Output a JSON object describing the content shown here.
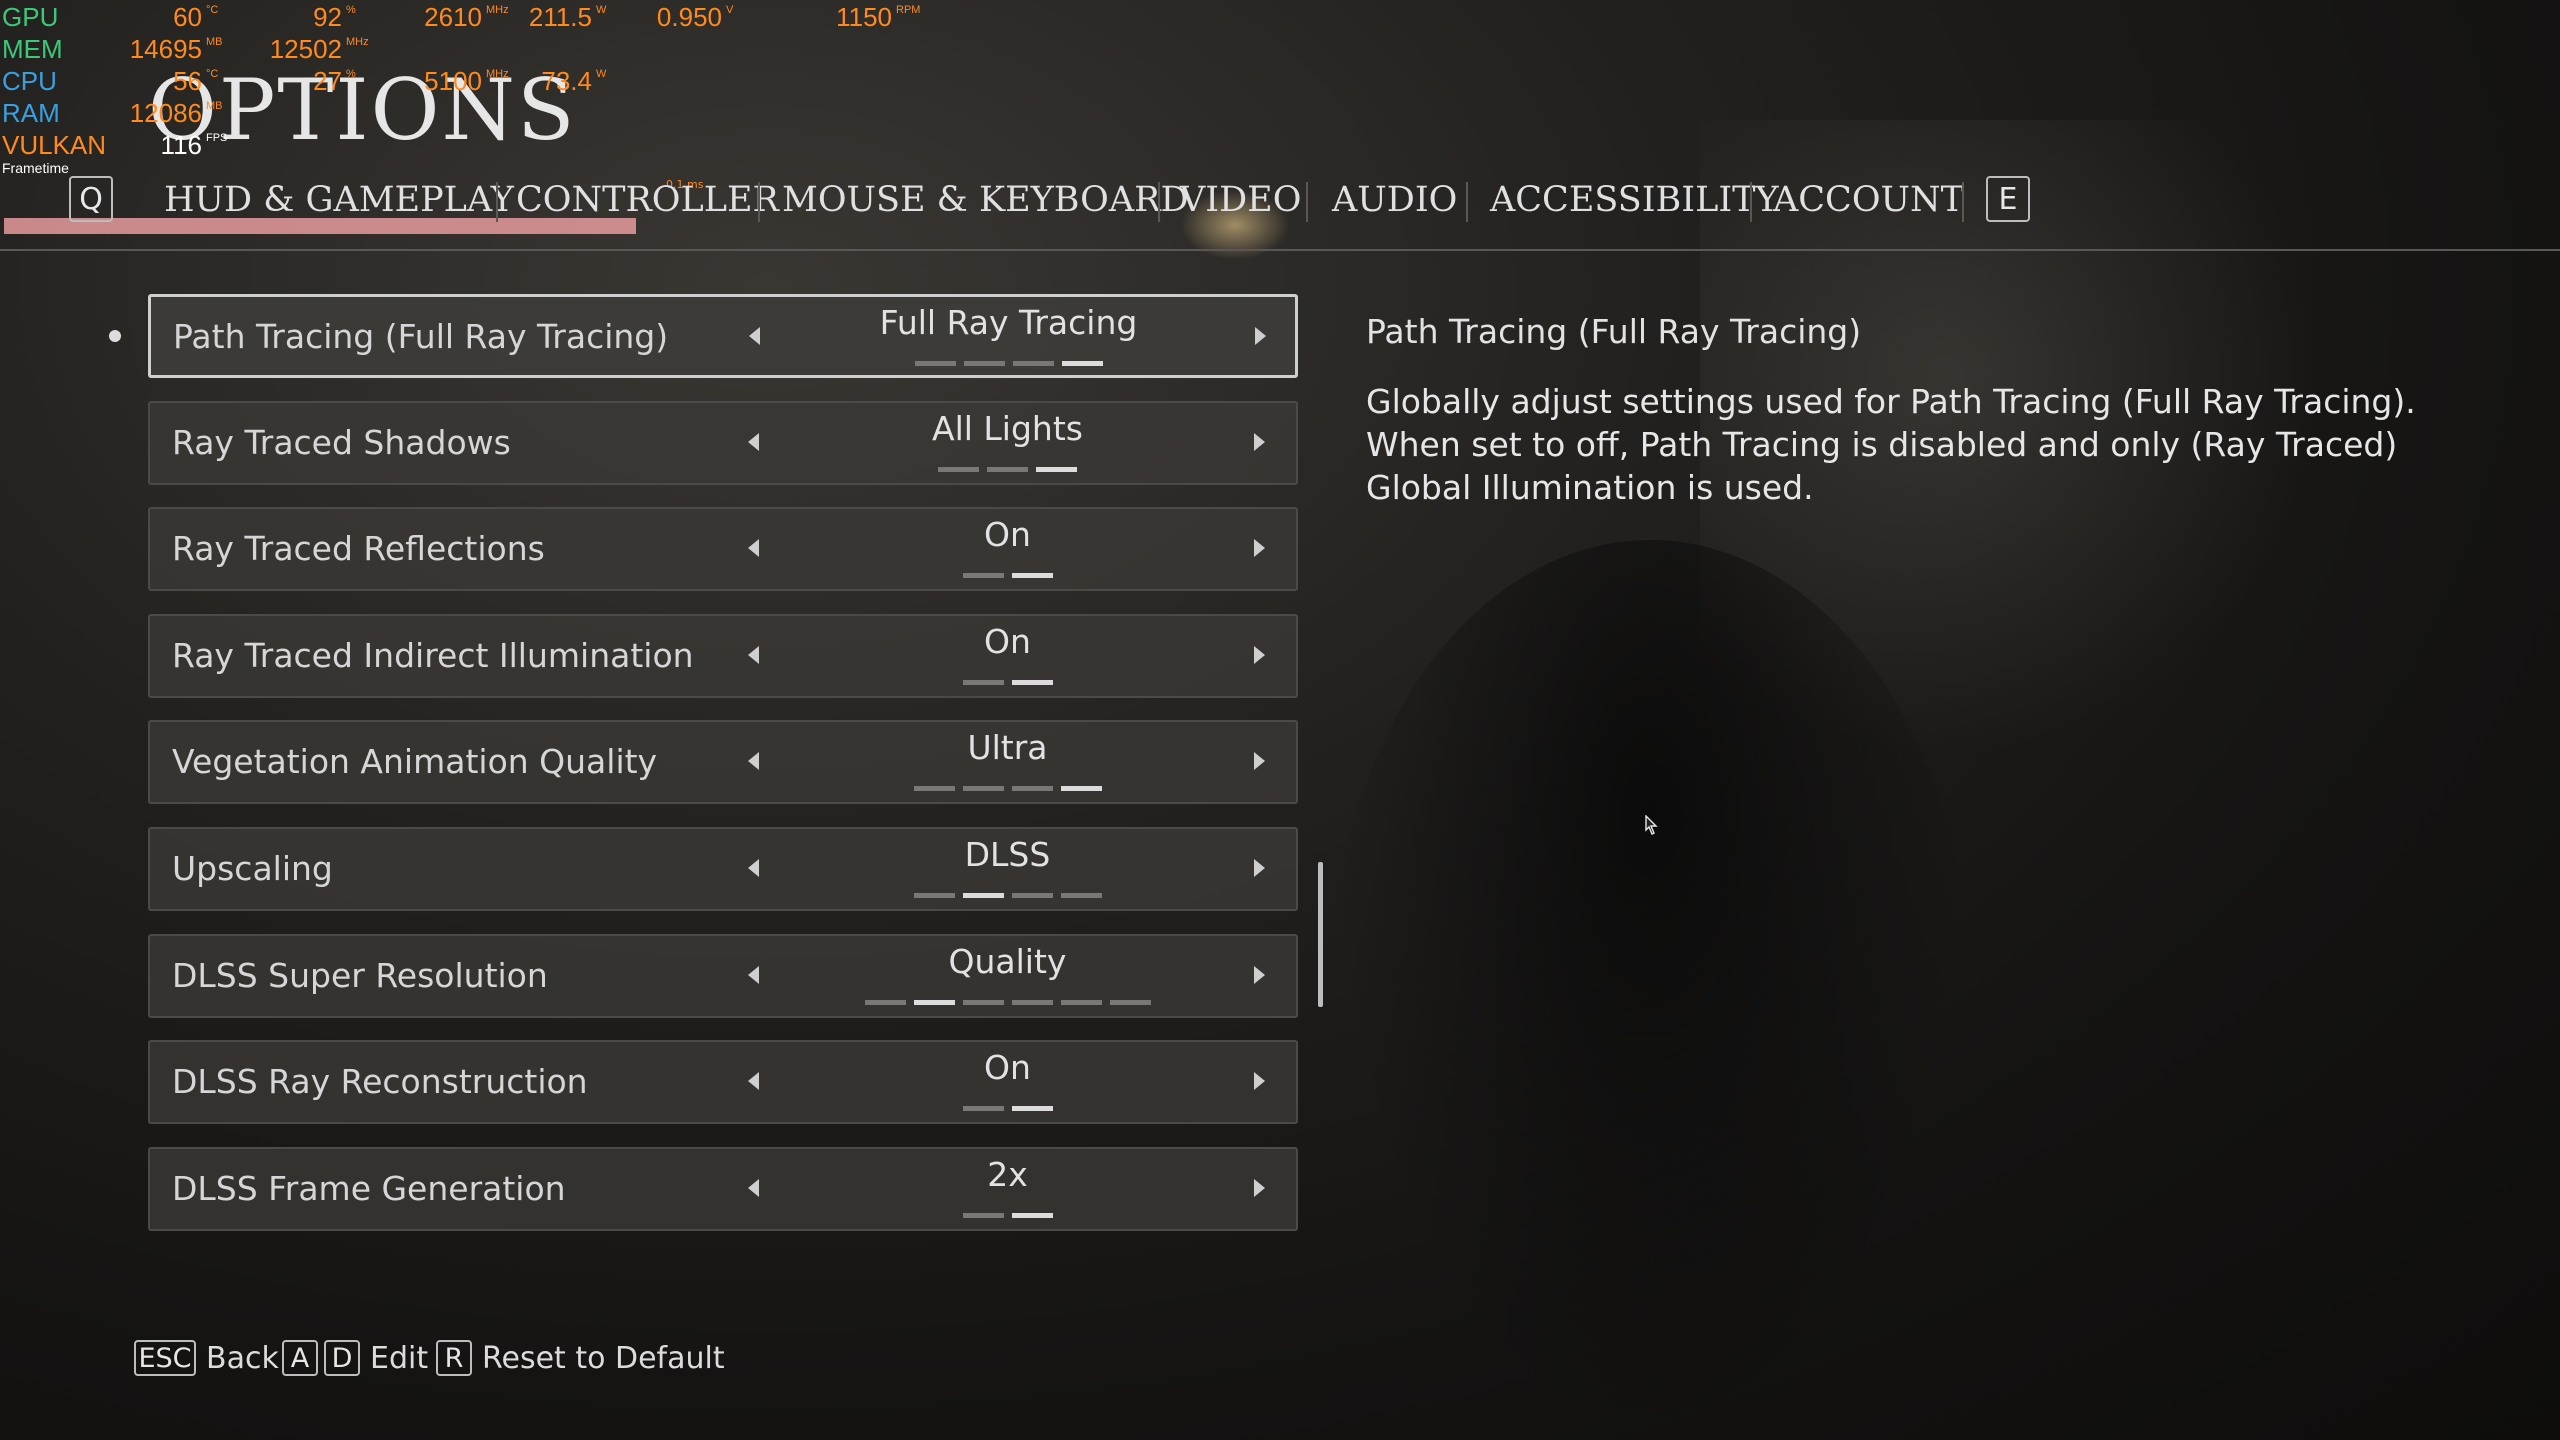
{
  "osd": {
    "rows": [
      {
        "label": "GPU",
        "label_color": "#3cc878",
        "values": [
          {
            "v": "60",
            "u": "°C"
          },
          {
            "v": "92",
            "u": "%"
          },
          {
            "v": "2610",
            "u": "MHz"
          },
          {
            "v": "211.5",
            "u": "W"
          },
          {
            "v": "0.950",
            "u": "V"
          },
          {
            "v": "1150",
            "u": "RPM"
          }
        ]
      },
      {
        "label": "MEM",
        "label_color": "#3cc878",
        "values": [
          {
            "v": "14695",
            "u": "MB"
          },
          {
            "v": "12502",
            "u": "MHz"
          }
        ]
      },
      {
        "label": "CPU",
        "label_color": "#3aa0e0",
        "values": [
          {
            "v": "56",
            "u": "°C"
          },
          {
            "v": "27",
            "u": "%"
          },
          {
            "v": "5100",
            "u": "MHz"
          },
          {
            "v": "73.4",
            "u": "W"
          }
        ]
      },
      {
        "label": "RAM",
        "label_color": "#3aa0e0",
        "values": [
          {
            "v": "12086",
            "u": "MB"
          }
        ]
      },
      {
        "label": "VULKAN",
        "label_color": "#ff8a1e",
        "values": [
          {
            "v": "116",
            "u": "FPS"
          }
        ]
      }
    ],
    "frametime_label": "Frametime",
    "frametime_unit": "0.1 ms"
  },
  "page_title": "OPTIONS",
  "tabs": {
    "prev_key": "Q",
    "next_key": "E",
    "items": [
      {
        "label": "HUD & GAMEPLAY",
        "active": true
      },
      {
        "label": "CONTROLLER",
        "active": false
      },
      {
        "label": "MOUSE & KEYBOARD",
        "active": false
      },
      {
        "label": "VIDEO",
        "active": false
      },
      {
        "label": "AUDIO",
        "active": false
      },
      {
        "label": "ACCESSIBILITY",
        "active": false
      },
      {
        "label": "ACCOUNT",
        "active": false
      }
    ]
  },
  "settings": [
    {
      "label": "Path Tracing (Full Ray Tracing)",
      "value": "Full Ray Tracing",
      "levels": 4,
      "index": 3,
      "selected": true
    },
    {
      "label": "Ray Traced Shadows",
      "value": "All Lights",
      "levels": 3,
      "index": 2,
      "selected": false
    },
    {
      "label": "Ray Traced Reflections",
      "value": "On",
      "levels": 2,
      "index": 1,
      "selected": false
    },
    {
      "label": "Ray Traced Indirect Illumination",
      "value": "On",
      "levels": 2,
      "index": 1,
      "selected": false
    },
    {
      "label": "Vegetation Animation Quality",
      "value": "Ultra",
      "levels": 4,
      "index": 3,
      "selected": false
    },
    {
      "label": "Upscaling",
      "value": "DLSS",
      "levels": 4,
      "index": 1,
      "selected": false
    },
    {
      "label": "DLSS Super Resolution",
      "value": "Quality",
      "levels": 6,
      "index": 1,
      "selected": false
    },
    {
      "label": "DLSS Ray Reconstruction",
      "value": "On",
      "levels": 2,
      "index": 1,
      "selected": false
    },
    {
      "label": "DLSS Frame Generation",
      "value": "2x",
      "levels": 2,
      "index": 1,
      "selected": false
    }
  ],
  "description": {
    "title": "Path Tracing (Full Ray Tracing)",
    "body": "Globally adjust settings used for Path Tracing (Full Ray Tracing). When set to off, Path Tracing is disabled and only (Ray Traced) Global Illumination is used."
  },
  "footer": {
    "back_key": "ESC",
    "back_label": "Back",
    "edit_key_a": "A",
    "edit_key_d": "D",
    "edit_label": "Edit",
    "reset_key": "R",
    "reset_label": "Reset to Default"
  },
  "icons": {
    "arrow_left": "arrow-left-icon",
    "arrow_right": "arrow-right-icon",
    "cursor": "mouse-cursor-icon"
  }
}
